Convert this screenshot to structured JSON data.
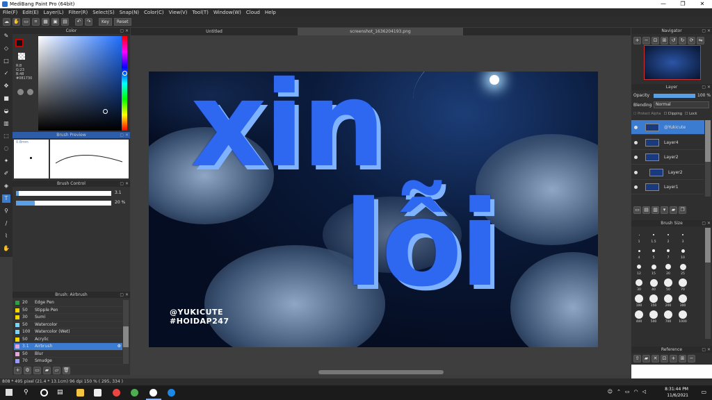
{
  "window": {
    "title": "MediBang Paint Pro (64bit)",
    "minimize": "—",
    "maximize": "❐",
    "close": "✕"
  },
  "menu": [
    "File(F)",
    "Edit(E)",
    "Layer(L)",
    "Filter(R)",
    "Select(S)",
    "Snap(N)",
    "Color(C)",
    "View(V)",
    "Tool(T)",
    "Window(W)",
    "Cloud",
    "Help"
  ],
  "toolbar": {
    "key_label": "Key",
    "reset_label": "Reset"
  },
  "panels": {
    "color": "Color",
    "brush_preview": "Brush Preview",
    "brush_control": "Brush Control",
    "brush_list_title": "Brush: Airbrush",
    "navigator": "Navigator",
    "layer": "Layer",
    "brush_size": "Brush Size",
    "reference": "Reference"
  },
  "color": {
    "r": "R:8",
    "g": "G:23",
    "b": "B:48",
    "hex": "#081730",
    "accent": "#081730"
  },
  "brush_preview": {
    "size_label": "0.8mm"
  },
  "brush_control": {
    "size_value": "3.1",
    "size_pct": 0.03,
    "opacity_value": "20 %",
    "opacity_pct": 0.2
  },
  "brushes": [
    {
      "num": "20",
      "name": "Edge Pen",
      "color": "#2ea043"
    },
    {
      "num": "50",
      "name": "Stipple Pen",
      "color": "#f2d600"
    },
    {
      "num": "30",
      "name": "Sumi",
      "color": "#f2d600"
    },
    {
      "num": "50",
      "name": "Watercolor",
      "color": "#7fd0f5"
    },
    {
      "num": "100",
      "name": "Watercolor (Wet)",
      "color": "#7fd0f5"
    },
    {
      "num": "50",
      "name": "Acrylic",
      "color": "#f2d600"
    },
    {
      "num": "3.1",
      "name": "Airbrush",
      "color": "#e4a6d8",
      "selected": true
    },
    {
      "num": "50",
      "name": "Blur",
      "color": "#e4a6d8"
    },
    {
      "num": "70",
      "name": "Smudge",
      "color": "#9b9bf5"
    }
  ],
  "tabs": {
    "untitled": "Untitled",
    "screenshot": "screenshot_1636204193.png"
  },
  "artwork": {
    "line1": "xin",
    "line2": "lỗi",
    "watermark1": "@YUKICUTE",
    "watermark2": "#HOIDAP247"
  },
  "layer": {
    "opacity_label": "Opacity",
    "opacity_value": "100 %",
    "blending_label": "Blending",
    "blending_value": "Normal",
    "protect_alpha": "Protect Alpha",
    "clipping": "Clipping",
    "lock": "Lock",
    "layers": [
      {
        "name": "@Yukicute",
        "selected": true
      },
      {
        "name": "Layer4"
      },
      {
        "name": "Layer2"
      },
      {
        "name": "Layer2"
      },
      {
        "name": "Layer1"
      }
    ]
  },
  "brush_sizes": [
    "1",
    "1.5",
    "2",
    "3",
    "4",
    "5",
    "7",
    "10",
    "12",
    "15",
    "20",
    "25",
    "30",
    "40",
    "50",
    "70",
    "100",
    "150",
    "200",
    "300",
    "400",
    "500",
    "700",
    "1000"
  ],
  "status": {
    "text": "808 * 495 pixel  (21.4 * 13.1cm)  96 dpi  150 %  ( 295, 334 )"
  },
  "taskbar": {
    "time": "8:31:44 PM",
    "date": "11/6/2021"
  }
}
